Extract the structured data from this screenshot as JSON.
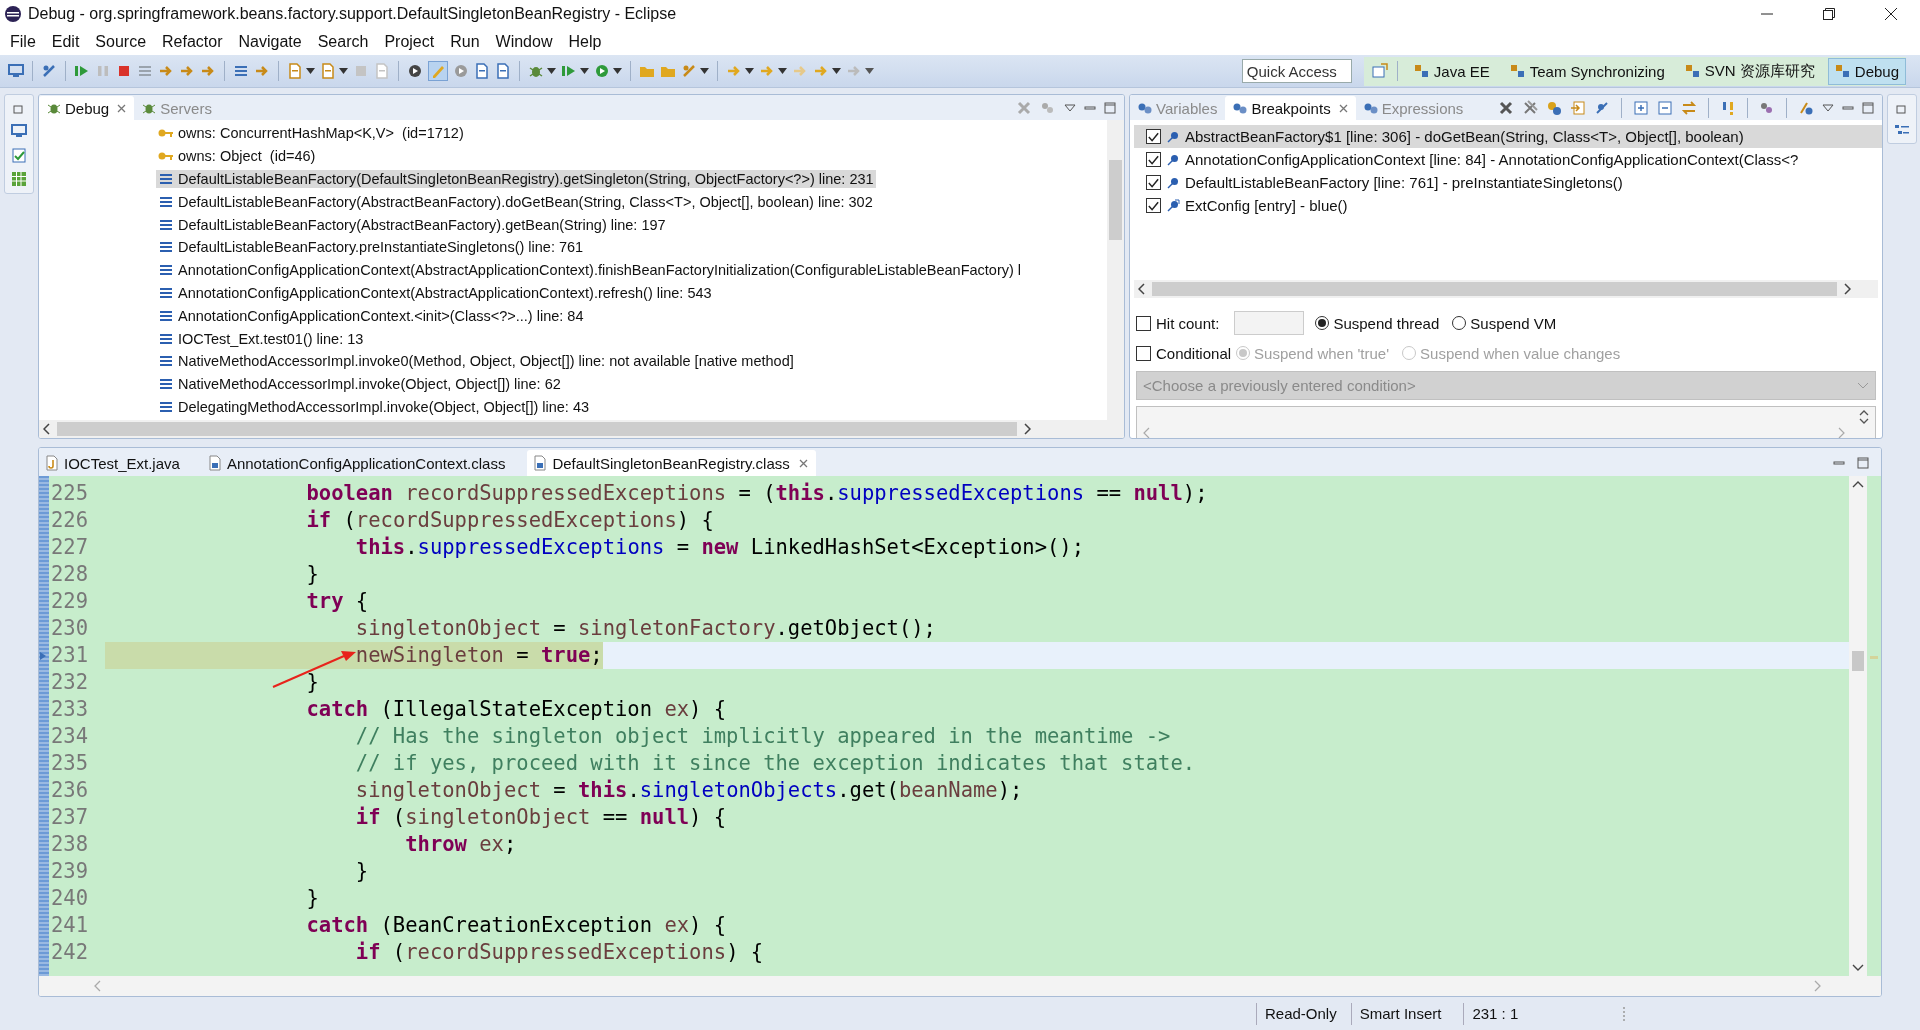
{
  "window": {
    "title": "Debug - org.springframework.beans.factory.support.DefaultSingletonBeanRegistry - Eclipse"
  },
  "menu": [
    "File",
    "Edit",
    "Source",
    "Refactor",
    "Navigate",
    "Search",
    "Project",
    "Run",
    "Window",
    "Help"
  ],
  "toolbar": {
    "highlight_toggle": {
      "on": true
    },
    "quick_access": {
      "placeholder": "Quick Access"
    },
    "perspectives": [
      {
        "label": "Java EE",
        "selected": false
      },
      {
        "label": "Team Synchronizing",
        "selected": false
      },
      {
        "label": "SVN 资源库研究",
        "selected": false
      },
      {
        "label": "Debug",
        "selected": true
      }
    ]
  },
  "debug_view": {
    "tabs": [
      {
        "label": "Debug",
        "selected": true
      },
      {
        "label": "Servers",
        "selected": false
      }
    ],
    "frames": [
      {
        "kind": "monitor",
        "text": "owns: ConcurrentHashMap<K,V>  (id=1712)",
        "selected": false
      },
      {
        "kind": "monitor",
        "text": "owns: Object  (id=46)",
        "selected": false
      },
      {
        "kind": "frame",
        "text": "DefaultListableBeanFactory(DefaultSingletonBeanRegistry).getSingleton(String, ObjectFactory<?>) line: 231",
        "selected": true
      },
      {
        "kind": "frame",
        "text": "DefaultListableBeanFactory(AbstractBeanFactory).doGetBean(String, Class<T>, Object[], boolean) line: 302",
        "selected": false
      },
      {
        "kind": "frame",
        "text": "DefaultListableBeanFactory(AbstractBeanFactory).getBean(String) line: 197",
        "selected": false
      },
      {
        "kind": "frame",
        "text": "DefaultListableBeanFactory.preInstantiateSingletons() line: 761",
        "selected": false
      },
      {
        "kind": "frame",
        "text": "AnnotationConfigApplicationContext(AbstractApplicationContext).finishBeanFactoryInitialization(ConfigurableListableBeanFactory) l",
        "selected": false
      },
      {
        "kind": "frame",
        "text": "AnnotationConfigApplicationContext(AbstractApplicationContext).refresh() line: 543",
        "selected": false
      },
      {
        "kind": "frame",
        "text": "AnnotationConfigApplicationContext.<init>(Class<?>...) line: 84",
        "selected": false
      },
      {
        "kind": "frame",
        "text": "IOCTest_Ext.test01() line: 13",
        "selected": false
      },
      {
        "kind": "frame",
        "text": "NativeMethodAccessorImpl.invoke0(Method, Object, Object[]) line: not available [native method]",
        "selected": false
      },
      {
        "kind": "frame",
        "text": "NativeMethodAccessorImpl.invoke(Object, Object[]) line: 62",
        "selected": false
      },
      {
        "kind": "frame",
        "text": "DelegatingMethodAccessorImpl.invoke(Object, Object[]) line: 43",
        "selected": false
      }
    ]
  },
  "breakpoints_view": {
    "tabs": [
      {
        "label": "Variables",
        "selected": false
      },
      {
        "label": "Breakpoints",
        "selected": true
      },
      {
        "label": "Expressions",
        "selected": false
      }
    ],
    "breakpoints": [
      {
        "kind": "line",
        "checked": true,
        "selected": true,
        "text": "AbstractBeanFactory$1 [line: 306] - doGetBean(String, Class<T>, Object[], boolean)"
      },
      {
        "kind": "line",
        "checked": true,
        "selected": false,
        "text": "AnnotationConfigApplicationContext [line: 84] - AnnotationConfigApplicationContext(Class<?"
      },
      {
        "kind": "line",
        "checked": true,
        "selected": false,
        "text": "DefaultListableBeanFactory [line: 761] - preInstantiateSingletons()"
      },
      {
        "kind": "entry",
        "checked": true,
        "selected": false,
        "text": "ExtConfig [entry] - blue()"
      }
    ],
    "hit_count": {
      "label": "Hit count:",
      "checked": false
    },
    "suspend_options": [
      {
        "label": "Suspend thread",
        "selected": true
      },
      {
        "label": "Suspend VM",
        "selected": false
      }
    ],
    "conditional": {
      "label": "Conditional",
      "checked": false
    },
    "condition_options": [
      {
        "label": "Suspend when 'true'",
        "selected": true,
        "disabled": true
      },
      {
        "label": "Suspend when value changes",
        "selected": false,
        "disabled": true
      }
    ],
    "condition_history": {
      "placeholder": "<Choose a previously entered condition>"
    }
  },
  "editor": {
    "tabs": [
      {
        "label": "IOCTest_Ext.java",
        "kind": "java",
        "selected": false
      },
      {
        "label": "AnnotationConfigApplicationContext.class",
        "kind": "class",
        "selected": false
      },
      {
        "label": "DefaultSingletonBeanRegistry.class",
        "kind": "class",
        "selected": true
      }
    ],
    "lines": [
      {
        "number": "225",
        "current": false,
        "segments": [
          {
            "kind": "keyword",
            "text": "                boolean"
          },
          {
            "kind": "local",
            "text": " recordSuppressedExceptions"
          },
          {
            "kind": "plain",
            "text": " = ("
          },
          {
            "kind": "keyword",
            "text": "this"
          },
          {
            "kind": "plain",
            "text": "."
          },
          {
            "kind": "field",
            "text": "suppressedExceptions"
          },
          {
            "kind": "plain",
            "text": " == "
          },
          {
            "kind": "keyword",
            "text": "null"
          },
          {
            "kind": "plain",
            "text": ");"
          }
        ]
      },
      {
        "number": "226",
        "current": false,
        "segments": [
          {
            "kind": "keyword",
            "text": "                if"
          },
          {
            "kind": "plain",
            "text": " ("
          },
          {
            "kind": "local",
            "text": "recordSuppressedExceptions"
          },
          {
            "kind": "plain",
            "text": ") {"
          }
        ]
      },
      {
        "number": "227",
        "current": false,
        "segments": [
          {
            "kind": "keyword",
            "text": "                    this"
          },
          {
            "kind": "plain",
            "text": "."
          },
          {
            "kind": "field",
            "text": "suppressedExceptions"
          },
          {
            "kind": "plain",
            "text": " = "
          },
          {
            "kind": "keyword",
            "text": "new"
          },
          {
            "kind": "plain",
            "text": " LinkedHashSet<Exception>();"
          }
        ]
      },
      {
        "number": "228",
        "current": false,
        "segments": [
          {
            "kind": "plain",
            "text": "                }"
          }
        ]
      },
      {
        "number": "229",
        "current": false,
        "segments": [
          {
            "kind": "keyword",
            "text": "                try"
          },
          {
            "kind": "plain",
            "text": " {"
          }
        ]
      },
      {
        "number": "230",
        "current": false,
        "segments": [
          {
            "kind": "local",
            "text": "                    singletonObject"
          },
          {
            "kind": "plain",
            "text": " = "
          },
          {
            "kind": "local",
            "text": "singletonFactory"
          },
          {
            "kind": "plain",
            "text": ".getObject();"
          }
        ]
      },
      {
        "number": "231",
        "current": true,
        "segments": [
          {
            "kind": "local",
            "text": "                    newSingleton"
          },
          {
            "kind": "plain",
            "text": " = "
          },
          {
            "kind": "keyword",
            "text": "true"
          },
          {
            "kind": "plain",
            "text": ";"
          }
        ]
      },
      {
        "number": "232",
        "current": false,
        "segments": [
          {
            "kind": "plain",
            "text": "                }"
          }
        ]
      },
      {
        "number": "233",
        "current": false,
        "segments": [
          {
            "kind": "keyword",
            "text": "                catch"
          },
          {
            "kind": "plain",
            "text": " (IllegalStateException "
          },
          {
            "kind": "local",
            "text": "ex"
          },
          {
            "kind": "plain",
            "text": ") {"
          }
        ]
      },
      {
        "number": "234",
        "current": false,
        "segments": [
          {
            "kind": "comment",
            "text": "                    // Has the singleton object implicitly appeared in the meantime ->"
          }
        ]
      },
      {
        "number": "235",
        "current": false,
        "segments": [
          {
            "kind": "comment",
            "text": "                    // if yes, proceed with it since the exception indicates that state."
          }
        ]
      },
      {
        "number": "236",
        "current": false,
        "segments": [
          {
            "kind": "local",
            "text": "                    singletonObject"
          },
          {
            "kind": "plain",
            "text": " = "
          },
          {
            "kind": "keyword",
            "text": "this"
          },
          {
            "kind": "plain",
            "text": "."
          },
          {
            "kind": "field",
            "text": "singletonObjects"
          },
          {
            "kind": "plain",
            "text": ".get("
          },
          {
            "kind": "local",
            "text": "beanName"
          },
          {
            "kind": "plain",
            "text": ");"
          }
        ]
      },
      {
        "number": "237",
        "current": false,
        "segments": [
          {
            "kind": "keyword",
            "text": "                    if"
          },
          {
            "kind": "plain",
            "text": " ("
          },
          {
            "kind": "local",
            "text": "singletonObject"
          },
          {
            "kind": "plain",
            "text": " == "
          },
          {
            "kind": "keyword",
            "text": "null"
          },
          {
            "kind": "plain",
            "text": ") {"
          }
        ]
      },
      {
        "number": "238",
        "current": false,
        "segments": [
          {
            "kind": "keyword",
            "text": "                        throw"
          },
          {
            "kind": "local",
            "text": " ex"
          },
          {
            "kind": "plain",
            "text": ";"
          }
        ]
      },
      {
        "number": "239",
        "current": false,
        "segments": [
          {
            "kind": "plain",
            "text": "                    }"
          }
        ]
      },
      {
        "number": "240",
        "current": false,
        "segments": [
          {
            "kind": "plain",
            "text": "                }"
          }
        ]
      },
      {
        "number": "241",
        "current": false,
        "segments": [
          {
            "kind": "keyword",
            "text": "                catch"
          },
          {
            "kind": "plain",
            "text": " (BeanCreationException "
          },
          {
            "kind": "local",
            "text": "ex"
          },
          {
            "kind": "plain",
            "text": ") {"
          }
        ]
      },
      {
        "number": "242",
        "current": false,
        "segments": [
          {
            "kind": "keyword",
            "text": "                    if"
          },
          {
            "kind": "plain",
            "text": " ("
          },
          {
            "kind": "local",
            "text": "recordSuppressedExceptions"
          },
          {
            "kind": "plain",
            "text": ") {"
          }
        ]
      }
    ]
  },
  "status_bar": [
    "Read-Only",
    "Smart Insert",
    "231 : 1"
  ]
}
